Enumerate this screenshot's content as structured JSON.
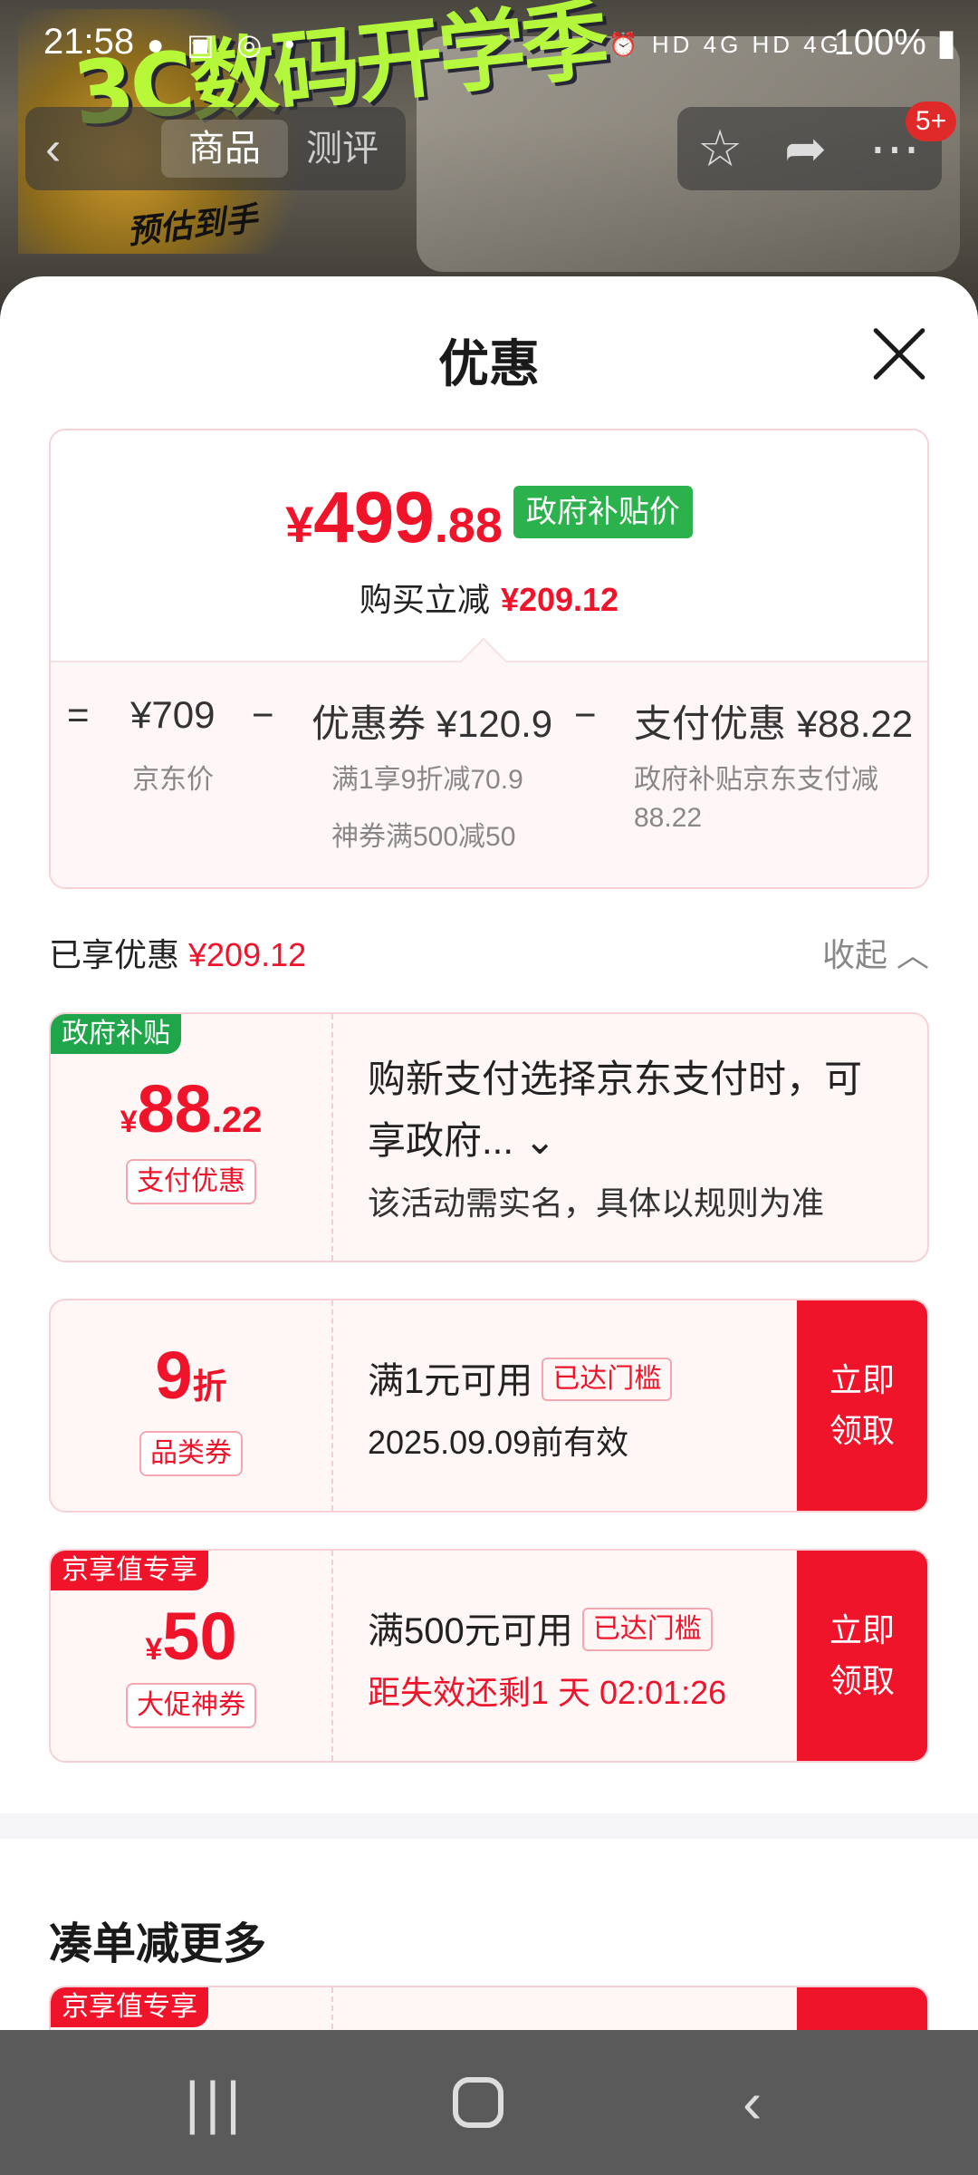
{
  "status_bar": {
    "time": "21:58",
    "left_icons": "● ▣ ◎ •",
    "right_icons": "⏰ HD 4G HD 4G",
    "battery": "100%"
  },
  "top_nav": {
    "tabs": [
      "商品",
      "测评"
    ],
    "badge": "5+"
  },
  "background": {
    "promo_text": "3C数码开学季",
    "promo_sub": "预估到手"
  },
  "sheet": {
    "title": "优惠",
    "summary": {
      "price_yen": "¥",
      "price_int": "499",
      "price_dec": ".88",
      "price_tag": "政府补贴价",
      "reduce_label": "购买立减",
      "reduce_amount": "¥209.12",
      "eq": "=",
      "jd_price": "¥709",
      "jd_price_label": "京东价",
      "minus1": "−",
      "coupon_label": "优惠券 ¥120.9",
      "coupon_sub1": "满1享9折减70.9",
      "coupon_sub2": "神券满500减50",
      "minus2": "−",
      "pay_label": "支付优惠 ¥88.22",
      "pay_sub": "政府补贴京东支付减88.22"
    },
    "enjoyed": {
      "label": "已享优惠",
      "amount": "¥209.12",
      "collapse": "收起"
    },
    "cards": [
      {
        "tag": "政府补贴",
        "value_prefix": "¥",
        "value_int": "88",
        "value_dec": ".22",
        "pill": "支付优惠",
        "title": "购新支付选择京东支付时，可享政府...",
        "note": "该活动需实名，具体以规则为准"
      },
      {
        "value_int": "9",
        "value_suffix": "折",
        "pill": "品类券",
        "condition": "满1元可用",
        "reached": "已达门槛",
        "date": "2025.09.09前有效",
        "button": "立即领取"
      },
      {
        "tag": "京享值专享",
        "value_prefix": "¥",
        "value_int": "50",
        "pill": "大促神券",
        "condition": "满500元可用",
        "reached": "已达门槛",
        "countdown": "距失效还剩1 天 02:01:26",
        "button": "立即领取"
      }
    ],
    "more_title": "凑单减更多",
    "more_tag": "京享值专享"
  }
}
